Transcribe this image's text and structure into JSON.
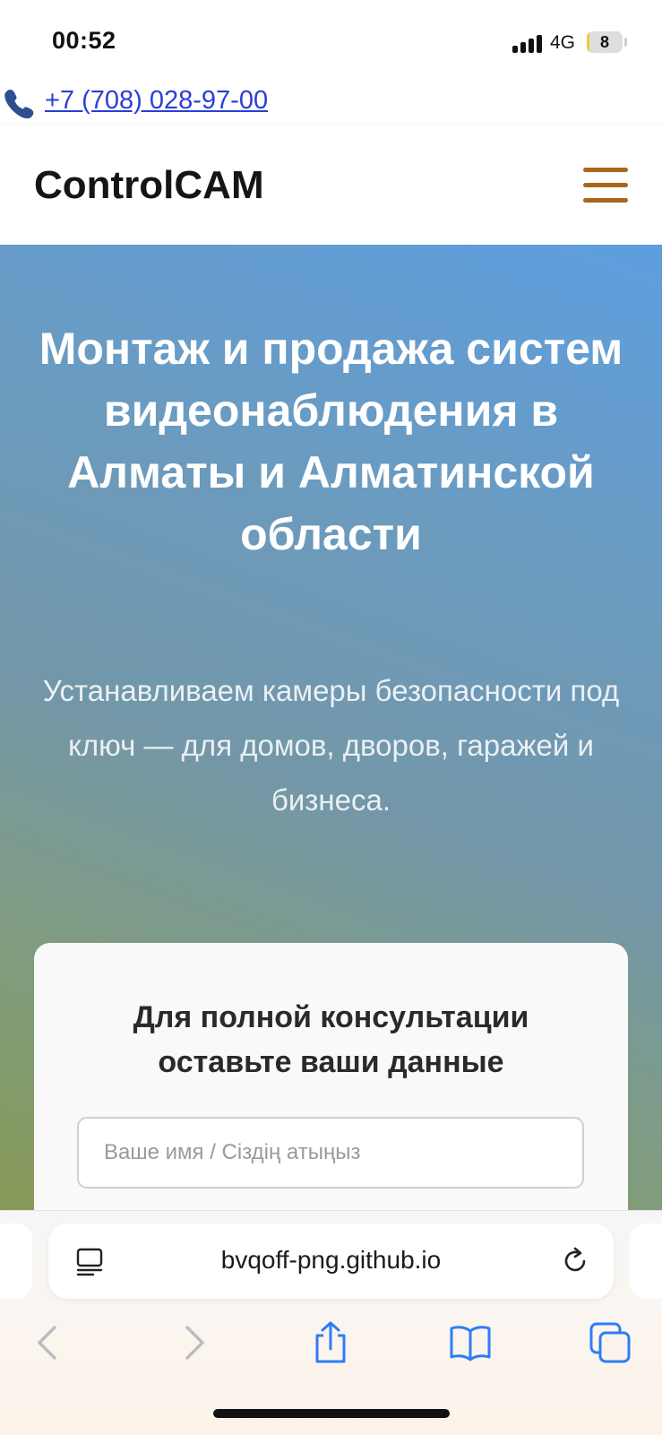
{
  "status_bar": {
    "time": "00:52",
    "network": "4G",
    "battery": "8",
    "battery_level_percent": 8
  },
  "phone": {
    "icon": "phone-icon",
    "number": "+7 (708) 028-97-00"
  },
  "header": {
    "brand": "ControlCAM",
    "menu_icon": "hamburger-menu-icon",
    "accent_color": "#a8681a"
  },
  "hero": {
    "title": "Монтаж и продажа систем видеонаблюдения в Алматы и Алматинской области",
    "subtitle": "Устанавливаем камеры безопасности под ключ — для домов, дворов, гаражей и бизнеса."
  },
  "form": {
    "title": "Для полной консультации оставьте ваши данные",
    "name_placeholder": "Ваше имя / Сіздің атыңыз"
  },
  "browser": {
    "url": "bvqoff-png.github.io",
    "reader_icon": "reader-mode-icon",
    "reload_icon": "reload-icon",
    "toolbar": [
      "back-icon",
      "forward-icon",
      "share-icon",
      "bookmarks-icon",
      "tabs-icon"
    ],
    "accent_color": "#2f7cf6"
  }
}
